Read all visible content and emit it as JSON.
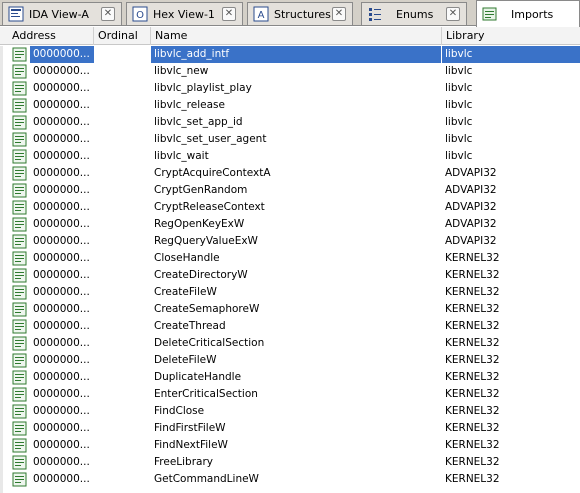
{
  "tabs": [
    {
      "label": "IDA View-A",
      "icon": "ida-view-icon",
      "active": false
    },
    {
      "label": "Hex View-1",
      "icon": "hex-view-icon",
      "active": false
    },
    {
      "label": "Structures",
      "icon": "structures-icon",
      "active": false
    },
    {
      "label": "Enums",
      "icon": "enums-icon",
      "active": false
    },
    {
      "label": "Imports",
      "icon": "imports-icon",
      "active": true
    }
  ],
  "close_glyph": "✕",
  "columns": {
    "address": "Address",
    "ordinal": "Ordinal",
    "name": "Name",
    "library": "Library"
  },
  "rows": [
    {
      "address": "0000000...",
      "ordinal": "",
      "name": "libvlc_add_intf",
      "library": "libvlc",
      "selected": true
    },
    {
      "address": "0000000...",
      "ordinal": "",
      "name": "libvlc_new",
      "library": "libvlc"
    },
    {
      "address": "0000000...",
      "ordinal": "",
      "name": "libvlc_playlist_play",
      "library": "libvlc"
    },
    {
      "address": "0000000...",
      "ordinal": "",
      "name": "libvlc_release",
      "library": "libvlc"
    },
    {
      "address": "0000000...",
      "ordinal": "",
      "name": "libvlc_set_app_id",
      "library": "libvlc"
    },
    {
      "address": "0000000...",
      "ordinal": "",
      "name": "libvlc_set_user_agent",
      "library": "libvlc"
    },
    {
      "address": "0000000...",
      "ordinal": "",
      "name": "libvlc_wait",
      "library": "libvlc"
    },
    {
      "address": "0000000...",
      "ordinal": "",
      "name": "CryptAcquireContextA",
      "library": "ADVAPI32"
    },
    {
      "address": "0000000...",
      "ordinal": "",
      "name": "CryptGenRandom",
      "library": "ADVAPI32"
    },
    {
      "address": "0000000...",
      "ordinal": "",
      "name": "CryptReleaseContext",
      "library": "ADVAPI32"
    },
    {
      "address": "0000000...",
      "ordinal": "",
      "name": "RegOpenKeyExW",
      "library": "ADVAPI32"
    },
    {
      "address": "0000000...",
      "ordinal": "",
      "name": "RegQueryValueExW",
      "library": "ADVAPI32"
    },
    {
      "address": "0000000...",
      "ordinal": "",
      "name": "CloseHandle",
      "library": "KERNEL32"
    },
    {
      "address": "0000000...",
      "ordinal": "",
      "name": "CreateDirectoryW",
      "library": "KERNEL32"
    },
    {
      "address": "0000000...",
      "ordinal": "",
      "name": "CreateFileW",
      "library": "KERNEL32"
    },
    {
      "address": "0000000...",
      "ordinal": "",
      "name": "CreateSemaphoreW",
      "library": "KERNEL32"
    },
    {
      "address": "0000000...",
      "ordinal": "",
      "name": "CreateThread",
      "library": "KERNEL32"
    },
    {
      "address": "0000000...",
      "ordinal": "",
      "name": "DeleteCriticalSection",
      "library": "KERNEL32"
    },
    {
      "address": "0000000...",
      "ordinal": "",
      "name": "DeleteFileW",
      "library": "KERNEL32"
    },
    {
      "address": "0000000...",
      "ordinal": "",
      "name": "DuplicateHandle",
      "library": "KERNEL32"
    },
    {
      "address": "0000000...",
      "ordinal": "",
      "name": "EnterCriticalSection",
      "library": "KERNEL32"
    },
    {
      "address": "0000000...",
      "ordinal": "",
      "name": "FindClose",
      "library": "KERNEL32"
    },
    {
      "address": "0000000...",
      "ordinal": "",
      "name": "FindFirstFileW",
      "library": "KERNEL32"
    },
    {
      "address": "0000000...",
      "ordinal": "",
      "name": "FindNextFileW",
      "library": "KERNEL32"
    },
    {
      "address": "0000000...",
      "ordinal": "",
      "name": "FreeLibrary",
      "library": "KERNEL32"
    },
    {
      "address": "0000000...",
      "ordinal": "",
      "name": "GetCommandLineW",
      "library": "KERNEL32"
    }
  ]
}
